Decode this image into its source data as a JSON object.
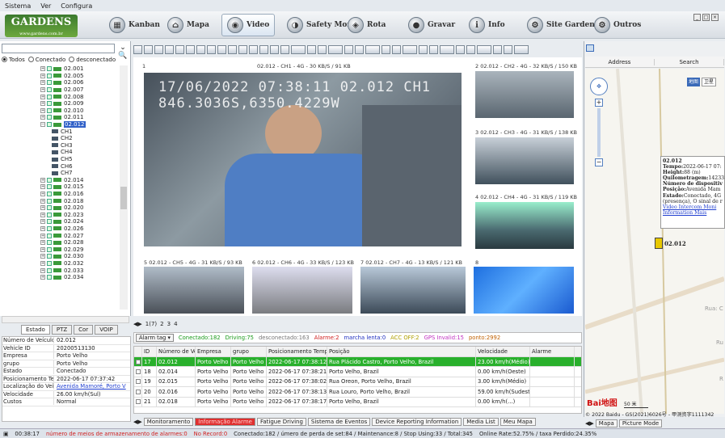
{
  "menu": {
    "items": [
      "Sistema",
      "Ver",
      "Configura"
    ]
  },
  "logo": {
    "name": "GARDENS",
    "url": "www.gardens.com.br"
  },
  "nav": [
    {
      "label": "Kanban",
      "icon": "kanban-icon"
    },
    {
      "label": "Mapa",
      "icon": "map-icon"
    },
    {
      "label": "Video",
      "icon": "video-icon"
    },
    {
      "label": "Safety Mon",
      "icon": "safety-icon"
    },
    {
      "label": "Rota",
      "icon": "route-icon"
    },
    {
      "label": "Gravar",
      "icon": "record-icon"
    },
    {
      "label": "Info",
      "icon": "info-icon"
    },
    {
      "label": "Site Garden",
      "icon": "site-icon"
    },
    {
      "label": "Outros",
      "icon": "other-icon"
    }
  ],
  "filters": {
    "all": "Todos",
    "connected": "Conectado",
    "disconnected": "desconectado"
  },
  "tree": {
    "vehicles_before": [
      "02.001",
      "02.005",
      "02.006",
      "02.007",
      "02.008",
      "02.009",
      "02.010",
      "02.011"
    ],
    "selected": "02.012",
    "channels": [
      "CH1",
      "CH2",
      "CH3",
      "CH4",
      "CH5",
      "CH6",
      "CH7"
    ],
    "vehicles_after": [
      "02.014",
      "02.015",
      "02.016",
      "02.018",
      "02.020",
      "02.023",
      "02.024",
      "02.026",
      "02.027",
      "02.028",
      "02.029",
      "02.030",
      "02.032",
      "02.033",
      "02.034"
    ]
  },
  "left_tabs": [
    "Estado",
    "PTZ",
    "Cor",
    "VOIP"
  ],
  "info": [
    {
      "k": "Número de Veículos",
      "v": "02.012"
    },
    {
      "k": "Vehicle ID",
      "v": "20200513130"
    },
    {
      "k": "Empresa",
      "v": "Porto Velho"
    },
    {
      "k": "grupo",
      "v": "Porto Velho"
    },
    {
      "k": "Estado",
      "v": "Conectado"
    },
    {
      "k": "Posicionamento Temp",
      "v": "2022-06-17 07:37:42"
    },
    {
      "k": "Localização do Veículo",
      "v": "Avenida Mamoré, Porto V",
      "link": true
    },
    {
      "k": "Velocidade",
      "v": "26.00 km/h(Sul)"
    },
    {
      "k": "Custos",
      "v": "Normal"
    }
  ],
  "video": {
    "main_num": "1",
    "main_caption": "02.012 - CH1 - 4G - 30 KB/S / 91 KB",
    "osd_line1": "17/06/2022 07:38:11  02.012      CH1",
    "osd_line2": "846.3036S,6350.4229W",
    "thumbs": [
      {
        "cap": "2  02.012 - CH2 - 4G - 32 KB/S / 150 KB"
      },
      {
        "cap": "3  02.012 - CH3 - 4G - 31 KB/S / 138 KB"
      },
      {
        "cap": "4  02.012 - CH4 - 4G - 31 KB/S / 119 KB"
      },
      {
        "cap": "5  02.012 - CH5 - 4G - 31 KB/S / 93 KB"
      },
      {
        "cap": "6  02.012 - CH6 - 4G - 33 KB/S / 123 KB"
      },
      {
        "cap": "7  02.012 - CH7 - 4G - 13 KB/S / 121 KB"
      },
      {
        "cap": "8"
      }
    ]
  },
  "page_tabs": [
    "1(7)",
    "2",
    "3",
    "4"
  ],
  "alarm_bar": {
    "tag": "Alarm tag",
    "connected": "Conectado:182",
    "driving": "Driving:75",
    "disconnected": "desconectado:163",
    "alarm": "Alarme:2",
    "idle": "marcha lenta:0",
    "acc": "ACC OFF:2",
    "gps": "GPS Invalid:15",
    "ponto": "ponto:2992"
  },
  "grid": {
    "headers": [
      "ID",
      "Número de Veíc",
      "Empresa",
      "grupo",
      "Posicionamento Tempo",
      "Posição",
      "Velocidade",
      "Alarme"
    ],
    "rows": [
      [
        "17",
        "02.012",
        "Porto Velho",
        "Porto Velho",
        "2022-06-17 07:38:12",
        "Rua Plácido Castro, Porto Velho, Brazil",
        "23.00 km/h(Médio)",
        ""
      ],
      [
        "18",
        "02.014",
        "Porto Velho",
        "Porto Velho",
        "2022-06-17 07:38:21",
        "Porto Velho, Brazil",
        "0.00 km/h(Oeste)",
        ""
      ],
      [
        "19",
        "02.015",
        "Porto Velho",
        "Porto Velho",
        "2022-06-17 07:38:02",
        "Rua Oreon, Porto Velho, Brazil",
        "3.00 km/h(Médio)",
        ""
      ],
      [
        "20",
        "02.016",
        "Porto Velho",
        "Porto Velho",
        "2022-06-17 07:38:13",
        "Rua Louro, Porto Velho, Brazil",
        "59.00 km/h(Sudeste)",
        ""
      ],
      [
        "21",
        "02.018",
        "Porto Velho",
        "Porto Velho",
        "2022-06-17 07:38:17",
        "Porto Velho, Brazil",
        "0.00 km/h(...)",
        ""
      ]
    ]
  },
  "bottom_tabs": [
    "Monitoramento",
    "Informação Alarme",
    "Fatigue Driving",
    "Sistema de Eventos",
    "Device Reporting Information",
    "Media List",
    "Meu Mapa"
  ],
  "map": {
    "headers": [
      "Address",
      "Search"
    ],
    "map_btn": "地图",
    "sat_btn": "卫星",
    "popup": {
      "title": "02.012",
      "tempo": "2022-06-17 07:",
      "height": "88 (m)",
      "quilometragem": "14233",
      "dispositivo": "Número de dispositiv",
      "posicao": "Avenida Mam",
      "estado": "Conectado, 4G",
      "extra": "(presença), O sinal de r",
      "links": "Video Intercom Moni",
      "info": "Information Mais"
    },
    "marker": "02.012",
    "road1": "Rua: C",
    "road2": "Ru",
    "road3": "R",
    "scale": "50 米",
    "logo": "Bai地图",
    "copyright": "© 2022 Baidu - GS(2021)6026号 - 甲测资字1111342",
    "tabs": [
      "Mapa",
      "Picture Mode"
    ]
  },
  "status": {
    "time": "00:38:17",
    "media": "número de meios de armazenamento de alarmes:0",
    "norecord": "No Record:0",
    "summary": "Conectado:182 / úmero de perda de set:84 / Maintenance:8 / Stop Using:33 / Total:345",
    "online": "Online Rate:52.75% / taxa Perdido:24.35%"
  }
}
